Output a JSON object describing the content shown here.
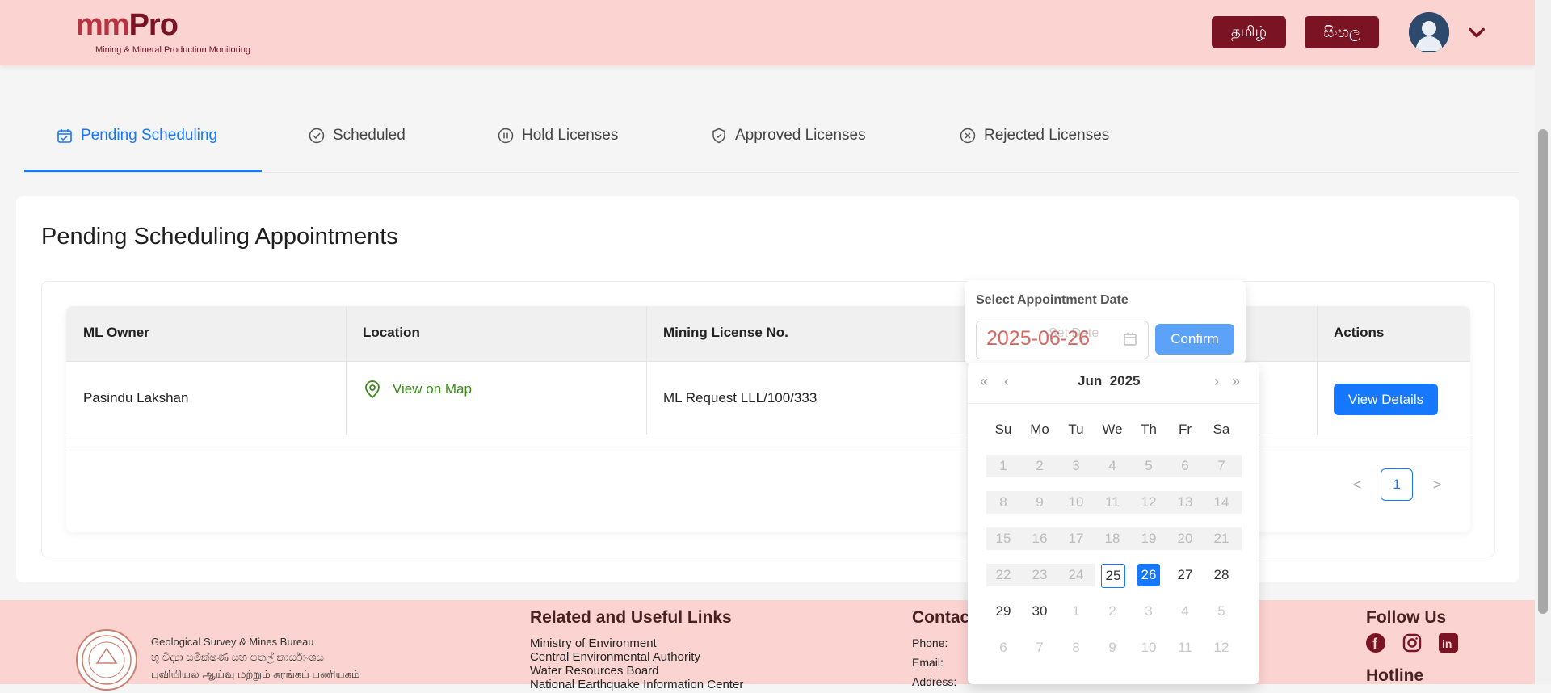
{
  "header": {
    "logo_mm": "mm",
    "logo_pro": "Pro",
    "logo_subtitle": "Mining & Mineral Production Monitoring",
    "lang_tamil": "தமிழ்",
    "lang_sinhala": "සිංහල"
  },
  "tabs": [
    {
      "label": "Pending Scheduling"
    },
    {
      "label": "Scheduled"
    },
    {
      "label": "Hold Licenses"
    },
    {
      "label": "Approved Licenses"
    },
    {
      "label": "Rejected Licenses"
    }
  ],
  "main": {
    "title": "Pending Scheduling Appointments",
    "columns": [
      "ML Owner",
      "Location",
      "Mining License No.",
      "Actions"
    ],
    "rows": [
      {
        "owner": "Pasindu Lakshan",
        "location": "View on Map",
        "license": "ML Request LLL/100/333",
        "action": "View Details"
      }
    ],
    "pager": {
      "prev": "<",
      "page": "1",
      "next": ">"
    }
  },
  "popover": {
    "label": "Select Appointment Date",
    "placeholder": "Set Date",
    "value": "2025-06-26",
    "confirm": "Confirm"
  },
  "calendar": {
    "nav_prev_year": "«",
    "nav_prev_month": "‹",
    "nav_next_month": "›",
    "nav_next_year": "»",
    "month": "Jun",
    "year": "2025",
    "weekdays": [
      "Su",
      "Mo",
      "Tu",
      "We",
      "Th",
      "Fr",
      "Sa"
    ],
    "rows": [
      [
        "1",
        "2",
        "3",
        "4",
        "5",
        "6",
        "7"
      ],
      [
        "8",
        "9",
        "10",
        "11",
        "12",
        "13",
        "14"
      ],
      [
        "15",
        "16",
        "17",
        "18",
        "19",
        "20",
        "21"
      ],
      [
        "22",
        "23",
        "24",
        "25",
        "26",
        "27",
        "28"
      ],
      [
        "29",
        "30",
        "1",
        "2",
        "3",
        "4",
        "5"
      ],
      [
        "6",
        "7",
        "8",
        "9",
        "10",
        "11",
        "12"
      ]
    ],
    "today": "25",
    "selected": "26"
  },
  "footer": {
    "org_en": "Geological Survey & Mines Bureau",
    "org_si": "භූ විද්‍යා සමීක්ෂණ සහ පතල් කාර්යාංශය",
    "org_ta": "புவியியல் ஆய்வு மற்றும் சுரங்கப் பணியகம்",
    "links_title": "Related and Useful Links",
    "links": [
      "Ministry of Environment",
      "Central Environmental Authority",
      "Water Resources Board",
      "National Earthquake Information Center"
    ],
    "contact_title": "Contact",
    "contact_phone": "Phone:",
    "contact_email": "Email:",
    "contact_address": "Address:",
    "follow_title": "Follow Us",
    "hotline_title": "Hotline"
  }
}
